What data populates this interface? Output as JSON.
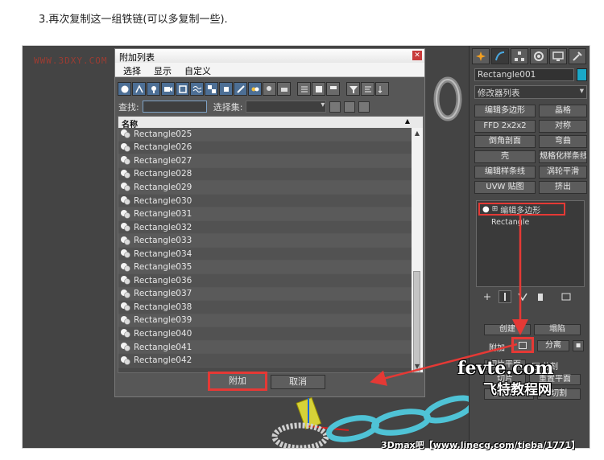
{
  "caption": "3.再次复制这一组铁链(可以多复制一些).",
  "watermark_top": "WWW.3DXY.COM",
  "dialog": {
    "title": "附加列表",
    "menu": [
      "选择",
      "显示",
      "自定义"
    ],
    "search_label": "查找:",
    "search_value": "",
    "selset_label": "选择集:",
    "selset_value": "",
    "column_header": "名称",
    "items": [
      "Rectangle025",
      "Rectangle026",
      "Rectangle027",
      "Rectangle028",
      "Rectangle029",
      "Rectangle030",
      "Rectangle031",
      "Rectangle032",
      "Rectangle033",
      "Rectangle034",
      "Rectangle035",
      "Rectangle036",
      "Rectangle037",
      "Rectangle038",
      "Rectangle039",
      "Rectangle040",
      "Rectangle041",
      "Rectangle042"
    ],
    "attach_button": "附加",
    "cancel_button": "取消"
  },
  "panel": {
    "object_name": "Rectangle001",
    "object_color": "#1aa8c8",
    "modifier_list": "修改器列表",
    "modifier_buttons": [
      "编辑多边形",
      "晶格",
      "FFD 2x2x2",
      "对称",
      "倒角剖面",
      "弯曲",
      "壳",
      "规格化样条线",
      "编辑样条线",
      "涡轮平滑",
      "UVW 贴图",
      "挤出"
    ],
    "stack_item": "编辑多边形",
    "stack_sub": "Rectangle",
    "create_button": "创建",
    "collapse_button": "塌陷",
    "attach_label": "附加",
    "detach_button": "分离",
    "slice_plane_button": "切片平面",
    "split_label": "分割",
    "slice_button": "切片",
    "reset_plane_button": "重置平面",
    "quickslice_button": "快速切片",
    "cut_button": "切割"
  },
  "watermarks": {
    "fevte": "fevte.com",
    "site_cn": "飞特教程网",
    "bottom": "3Dmax吧【www.linecg.com/tieba/1771】"
  },
  "accent": "#e53935"
}
